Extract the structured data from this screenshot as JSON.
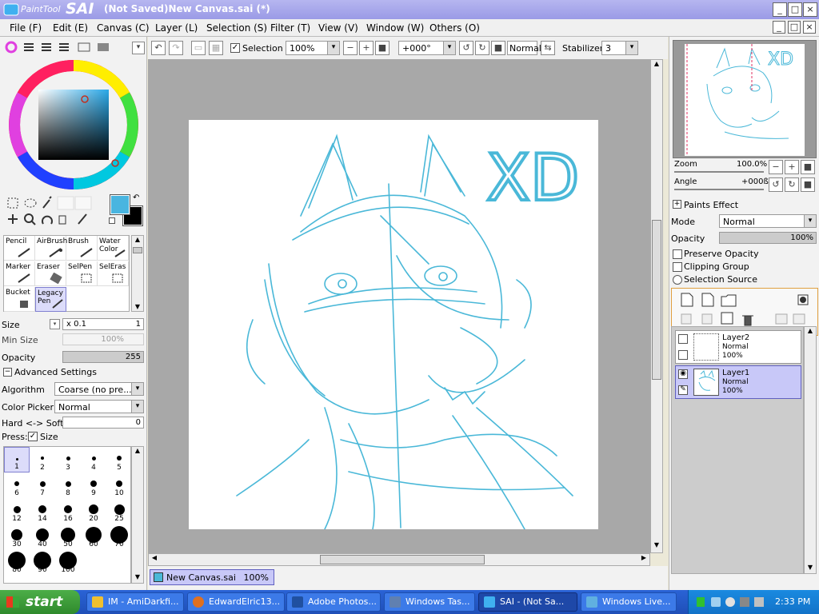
{
  "app": {
    "logo_small": "PaintTool",
    "logo_big": "SAI",
    "title": "(Not Saved)New Canvas.sai (*)"
  },
  "menu": [
    "File (F)",
    "Edit (E)",
    "Canvas (C)",
    "Layer (L)",
    "Selection (S)",
    "Filter (T)",
    "View (V)",
    "Window (W)",
    "Others (O)"
  ],
  "toolbar": {
    "selection_label": "Selection",
    "zoom": "100%",
    "rotation": "+000°",
    "blend": "Normal",
    "stabilizer_label": "Stabilizer",
    "stabilizer_value": "3"
  },
  "tools": [
    {
      "label": "Pencil"
    },
    {
      "label": "AirBrush"
    },
    {
      "label": "Brush"
    },
    {
      "label": "Water Color"
    },
    {
      "label": "Marker"
    },
    {
      "label": "Eraser"
    },
    {
      "label": "SelPen"
    },
    {
      "label": "SelEras"
    },
    {
      "label": "Bucket"
    },
    {
      "label": "Legacy Pen"
    }
  ],
  "brush": {
    "size_label": "Size",
    "size_mult": "x 0.1",
    "size_value": "1",
    "minsize_label": "Min Size",
    "minsize_value": "100%",
    "opacity_label": "Opacity",
    "opacity_value": "255",
    "advanced_label": "Advanced Settings",
    "algorithm_label": "Algorithm",
    "algorithm_value": "Coarse (no pre...",
    "picker_label": "Color Picker",
    "picker_value": "Normal",
    "hardsoft_label": "Hard <-> Soft",
    "hardsoft_value": "0",
    "press_label": "Press:",
    "press_size": "Size"
  },
  "brush_sizes": [
    "1",
    "2",
    "3",
    "4",
    "5",
    "6",
    "7",
    "8",
    "9",
    "10",
    "12",
    "14",
    "16",
    "20",
    "25",
    "30",
    "40",
    "50",
    "60",
    "70",
    "80",
    "90",
    "100"
  ],
  "navigator": {
    "zoom_label": "Zoom",
    "zoom_value": "100.0%",
    "angle_label": "Angle",
    "angle_value": "+000ß"
  },
  "layer_panel": {
    "paints_effect": "Paints Effect",
    "mode_label": "Mode",
    "mode_value": "Normal",
    "opacity_label": "Opacity",
    "opacity_value": "100%",
    "preserve": "Preserve Opacity",
    "clipping": "Clipping Group",
    "selection_source": "Selection Source",
    "layers": [
      {
        "name": "Layer2",
        "mode": "Normal",
        "opacity": "100%"
      },
      {
        "name": "Layer1",
        "mode": "Normal",
        "opacity": "100%"
      }
    ]
  },
  "canvas_tab": {
    "name": "New Canvas.sai",
    "zoom": "100%"
  },
  "drawing_text": "XD",
  "taskbar": {
    "start": "start",
    "tasks": [
      "IM - AmiDarkfi...",
      "EdwardElric13...",
      "Adobe Photos...",
      "Windows Tas...",
      "SAI - (Not Sa...",
      "Windows Live..."
    ],
    "clock": "2:33 PM"
  },
  "colors": {
    "sketch": "#4ab8d8",
    "accent": "#49b5e0",
    "primary": "#49b5e0",
    "secondary": "#000000"
  }
}
